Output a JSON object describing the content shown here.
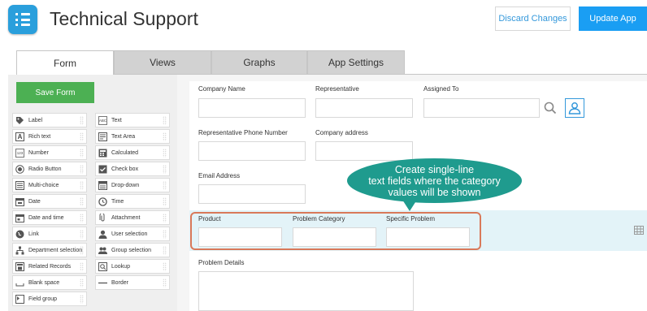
{
  "header": {
    "title": "Technical Support",
    "discard_label": "Discard Changes",
    "update_label": "Update App"
  },
  "tabs": [
    {
      "label": "Form",
      "active": true
    },
    {
      "label": "Views",
      "active": false
    },
    {
      "label": "Graphs",
      "active": false
    },
    {
      "label": "App Settings",
      "active": false
    }
  ],
  "palette": {
    "save_label": "Save Form",
    "items": [
      {
        "label": "Label",
        "icon": "tag-icon"
      },
      {
        "label": "Text",
        "icon": "text-field-icon"
      },
      {
        "label": "Rich text",
        "icon": "rich-text-icon"
      },
      {
        "label": "Text Area",
        "icon": "text-area-icon"
      },
      {
        "label": "Number",
        "icon": "number-icon"
      },
      {
        "label": "Calculated",
        "icon": "calculator-icon"
      },
      {
        "label": "Radio Button",
        "icon": "radio-icon"
      },
      {
        "label": "Check box",
        "icon": "checkbox-icon"
      },
      {
        "label": "Multi-choice",
        "icon": "multi-choice-icon"
      },
      {
        "label": "Drop-down",
        "icon": "dropdown-icon"
      },
      {
        "label": "Date",
        "icon": "calendar-icon"
      },
      {
        "label": "Time",
        "icon": "clock-icon"
      },
      {
        "label": "Date and time",
        "icon": "calendar-clock-icon"
      },
      {
        "label": "Attachment",
        "icon": "paperclip-icon"
      },
      {
        "label": "Link",
        "icon": "globe-icon"
      },
      {
        "label": "User selection",
        "icon": "user-icon"
      },
      {
        "label": "Department selection",
        "icon": "org-chart-icon"
      },
      {
        "label": "Group selection",
        "icon": "group-icon"
      },
      {
        "label": "Related Records",
        "icon": "related-records-icon"
      },
      {
        "label": "Lookup",
        "icon": "lookup-icon"
      },
      {
        "label": "Blank space",
        "icon": "blank-space-icon"
      },
      {
        "label": "Border",
        "icon": "border-line-icon"
      },
      {
        "label": "Field group",
        "icon": "field-group-icon"
      }
    ]
  },
  "form": {
    "company_name": "Company Name",
    "representative": "Representative",
    "assigned_to": "Assigned To",
    "rep_phone": "Representative Phone Number",
    "company_address": "Company address",
    "email": "Email Address",
    "product": "Product",
    "problem_category": "Problem Category",
    "specific_problem": "Specific Problem",
    "problem_details": "Problem Details"
  },
  "callout": {
    "line1": "Create single-line",
    "line2": "text fields where the category",
    "line3": "values will be shown"
  },
  "colors": {
    "accent": "#1a9ef3",
    "save": "#4cb053",
    "callout": "#1f9b8e",
    "highlight": "#d9795a"
  }
}
